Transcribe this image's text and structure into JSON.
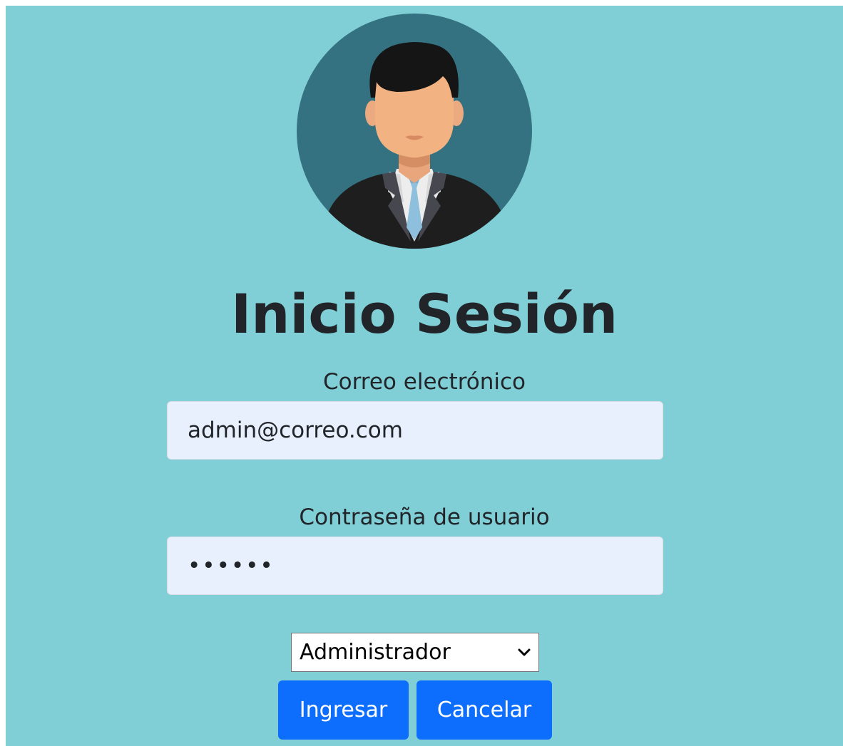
{
  "login": {
    "title": "Inicio Sesión",
    "email_label": "Correo electrónico",
    "email_value": "admin@correo.com",
    "password_label": "Contraseña de usuario",
    "password_value": "••••••",
    "role_selected": "Administrador",
    "submit_label": "Ingresar",
    "cancel_label": "Cancelar"
  },
  "icons": {
    "avatar": "user-avatar-icon",
    "select_arrow": "chevron-down-icon"
  },
  "colors": {
    "background": "#80cfd6",
    "avatar_circle": "#347282",
    "input_background": "#e8f0fe",
    "button": "#0d6efd",
    "text": "#212529"
  }
}
